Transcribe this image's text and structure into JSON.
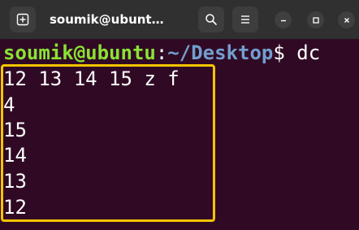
{
  "window": {
    "title": "soumik@ubunt…",
    "icons": {
      "new_tab": "new-tab-icon",
      "search": "search-icon",
      "menu": "hamburger-menu-icon",
      "minimize": "minimize-icon",
      "maximize": "maximize-icon",
      "close": "close-icon"
    }
  },
  "terminal": {
    "prompt": {
      "user_host": "soumik@ubuntu",
      "colon": ":",
      "path": "~/Desktop",
      "dollar": "$",
      "command": " dc"
    },
    "input_line": "12 13 14 15 z f",
    "output_lines": [
      "4",
      "15",
      "14",
      "13",
      "12"
    ]
  },
  "colors": {
    "background": "#300a24",
    "titlebar": "#303030",
    "prompt_user": "#8ae234",
    "prompt_path": "#729fcf",
    "highlight_box": "#f5c400"
  }
}
